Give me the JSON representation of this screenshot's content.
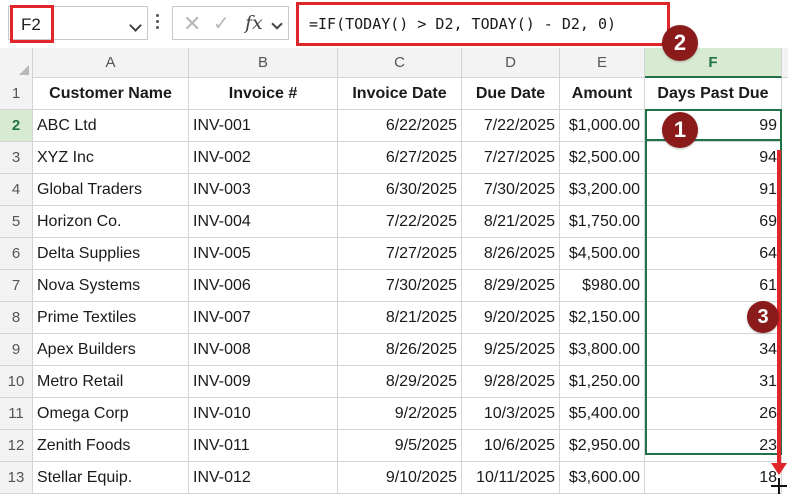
{
  "formula_bar": {
    "cell_reference": "F2",
    "formula": "=IF(TODAY() > D2, TODAY() - D2, 0)",
    "fx_label": "fx"
  },
  "callouts": [
    "1",
    "2",
    "3"
  ],
  "columns": [
    "A",
    "B",
    "C",
    "D",
    "E",
    "F"
  ],
  "rows": [
    "1",
    "2",
    "3",
    "4",
    "5",
    "6",
    "7",
    "8",
    "9",
    "10",
    "11",
    "12",
    "13"
  ],
  "headers": {
    "customer": "Customer Name",
    "invoice": "Invoice #",
    "invoice_date": "Invoice Date",
    "due_date": "Due Date",
    "amount": "Amount",
    "days": "Days Past Due"
  },
  "records": [
    {
      "customer": "ABC Ltd",
      "invoice": "INV-001",
      "invoice_date": "6/22/2025",
      "due_date": "7/22/2025",
      "amount": "$1,000.00",
      "days": "99"
    },
    {
      "customer": "XYZ Inc",
      "invoice": "INV-002",
      "invoice_date": "6/27/2025",
      "due_date": "7/27/2025",
      "amount": "$2,500.00",
      "days": "94"
    },
    {
      "customer": "Global Traders",
      "invoice": "INV-003",
      "invoice_date": "6/30/2025",
      "due_date": "7/30/2025",
      "amount": "$3,200.00",
      "days": "91"
    },
    {
      "customer": "Horizon Co.",
      "invoice": "INV-004",
      "invoice_date": "7/22/2025",
      "due_date": "8/21/2025",
      "amount": "$1,750.00",
      "days": "69"
    },
    {
      "customer": "Delta Supplies",
      "invoice": "INV-005",
      "invoice_date": "7/27/2025",
      "due_date": "8/26/2025",
      "amount": "$4,500.00",
      "days": "64"
    },
    {
      "customer": "Nova Systems",
      "invoice": "INV-006",
      "invoice_date": "7/30/2025",
      "due_date": "8/29/2025",
      "amount": "$980.00",
      "days": "61"
    },
    {
      "customer": "Prime Textiles",
      "invoice": "INV-007",
      "invoice_date": "8/21/2025",
      "due_date": "9/20/2025",
      "amount": "$2,150.00",
      "days": ""
    },
    {
      "customer": "Apex Builders",
      "invoice": "INV-008",
      "invoice_date": "8/26/2025",
      "due_date": "9/25/2025",
      "amount": "$3,800.00",
      "days": "34"
    },
    {
      "customer": "Metro Retail",
      "invoice": "INV-009",
      "invoice_date": "8/29/2025",
      "due_date": "9/28/2025",
      "amount": "$1,250.00",
      "days": "31"
    },
    {
      "customer": "Omega Corp",
      "invoice": "INV-010",
      "invoice_date": "9/2/2025",
      "due_date": "10/3/2025",
      "amount": "$5,400.00",
      "days": "26"
    },
    {
      "customer": "Zenith Foods",
      "invoice": "INV-011",
      "invoice_date": "9/5/2025",
      "due_date": "10/6/2025",
      "amount": "$2,950.00",
      "days": "23"
    },
    {
      "customer": "Stellar Equip.",
      "invoice": "INV-012",
      "invoice_date": "9/10/2025",
      "due_date": "10/11/2025",
      "amount": "$3,600.00",
      "days": "18"
    }
  ],
  "colors": {
    "callout_border": "#e0262b",
    "badge": "#8b1a1a",
    "selection": "#217346"
  }
}
